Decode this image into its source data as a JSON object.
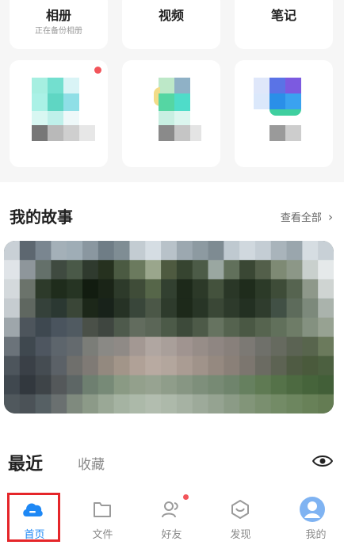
{
  "top_cards": [
    {
      "title": "相册",
      "subtitle": "正在备份相册"
    },
    {
      "title": "视频",
      "subtitle": ""
    },
    {
      "title": "笔记",
      "subtitle": ""
    }
  ],
  "stories": {
    "title": "我的故事",
    "view_all": "查看全部",
    "chevron": "›"
  },
  "recent": {
    "tab_recent": "最近",
    "tab_favorites": "收藏"
  },
  "tabbar": {
    "items": [
      {
        "label": "首页",
        "icon": "cloud-icon",
        "active": true
      },
      {
        "label": "文件",
        "icon": "folder-icon",
        "active": false
      },
      {
        "label": "好友",
        "icon": "friends-icon",
        "active": false,
        "badge": true
      },
      {
        "label": "发现",
        "icon": "discover-icon",
        "active": false
      },
      {
        "label": "我的",
        "icon": "avatar-icon",
        "active": false
      }
    ]
  },
  "colors": {
    "accent": "#1e88f5",
    "badge": "#f2555b",
    "highlight_box": "#e5262a"
  }
}
